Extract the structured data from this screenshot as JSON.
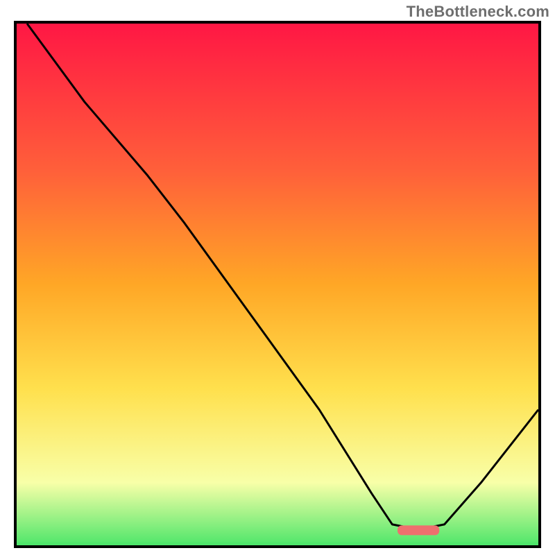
{
  "watermark": "TheBottleneck.com",
  "colors": {
    "gradient_top": "#ff1744",
    "gradient_mid1": "#ff5f3a",
    "gradient_mid2": "#ffa726",
    "gradient_mid3": "#ffe04d",
    "gradient_mid4": "#f8ffa8",
    "gradient_bottom": "#4ee66a",
    "curve": "#000000",
    "marker": "#ee706e",
    "frame": "#000000"
  },
  "chart_data": {
    "type": "line",
    "title": "",
    "xlabel": "",
    "ylabel": "",
    "xlim": [
      0,
      100
    ],
    "ylim": [
      0,
      100
    ],
    "annotations": [],
    "marker": {
      "x_start": 73,
      "x_end": 81,
      "y": 3
    },
    "series": [
      {
        "name": "curve",
        "points": [
          {
            "x": 2,
            "y": 100
          },
          {
            "x": 13,
            "y": 85
          },
          {
            "x": 25,
            "y": 71
          },
          {
            "x": 32,
            "y": 62
          },
          {
            "x": 45,
            "y": 44
          },
          {
            "x": 58,
            "y": 26
          },
          {
            "x": 68,
            "y": 10
          },
          {
            "x": 72,
            "y": 4
          },
          {
            "x": 77,
            "y": 3
          },
          {
            "x": 82,
            "y": 4
          },
          {
            "x": 89,
            "y": 12
          },
          {
            "x": 100,
            "y": 26
          }
        ]
      }
    ]
  }
}
